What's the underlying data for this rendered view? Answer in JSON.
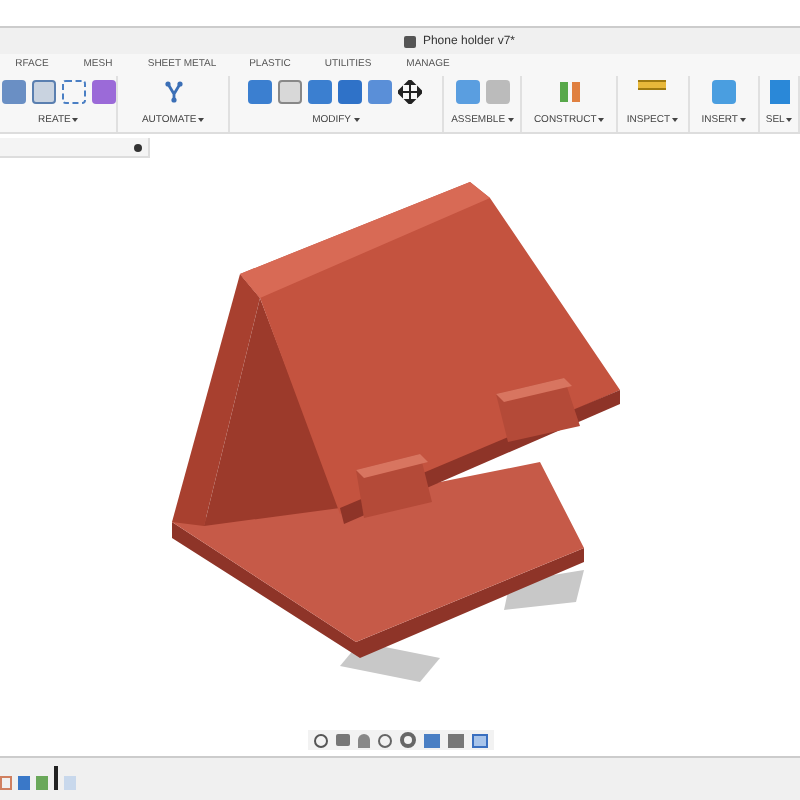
{
  "document": {
    "title": "Phone holder v7*"
  },
  "tabs": [
    {
      "label": "RFACE"
    },
    {
      "label": "MESH"
    },
    {
      "label": "SHEET METAL"
    },
    {
      "label": "PLASTIC"
    },
    {
      "label": "UTILITIES"
    },
    {
      "label": "MANAGE"
    }
  ],
  "groups": [
    {
      "label": "REATE"
    },
    {
      "label": "AUTOMATE"
    },
    {
      "label": "MODIFY"
    },
    {
      "label": "ASSEMBLE"
    },
    {
      "label": "CONSTRUCT"
    },
    {
      "label": "INSPECT"
    },
    {
      "label": "INSERT"
    },
    {
      "label": "SEL"
    }
  ]
}
